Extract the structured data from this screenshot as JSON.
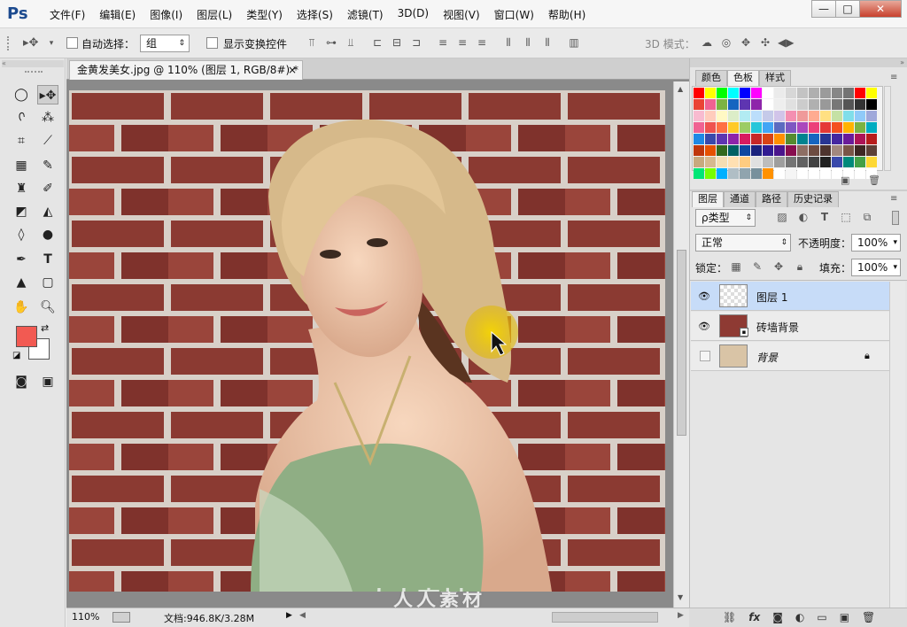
{
  "app": {
    "logo": "Ps"
  },
  "menu": [
    "文件(F)",
    "编辑(E)",
    "图像(I)",
    "图层(L)",
    "类型(Y)",
    "选择(S)",
    "滤镜(T)",
    "3D(D)",
    "视图(V)",
    "窗口(W)",
    "帮助(H)"
  ],
  "window_buttons": {
    "minimize": "—",
    "maximize": "□",
    "close": "✕"
  },
  "options": {
    "auto_select_label": "自动选择：",
    "auto_select_value": "组",
    "show_transform_label": "显示变换控件",
    "mode_3d_label": "3D 模式："
  },
  "document": {
    "tab_title": "金黄发美女.jpg @ 110% (图层 1, RGB/8#) *",
    "close": "×"
  },
  "status": {
    "zoom": "110%",
    "doc_info": "文档:946.8K/3.28M"
  },
  "panels": {
    "top_tabs": [
      "颜色",
      "色板",
      "样式"
    ],
    "layer_tabs": [
      "图层",
      "通道",
      "路径",
      "历史记录"
    ],
    "filter_kind": "ρ类型",
    "blend_mode": "正常",
    "opacity_label": "不透明度：",
    "opacity_value": "100%",
    "lock_label": "锁定：",
    "fill_label": "填充：",
    "fill_value": "100%"
  },
  "layers": [
    {
      "name": "图层 1",
      "visible": true,
      "selected": true
    },
    {
      "name": "砖墙背景",
      "visible": true,
      "selected": false
    },
    {
      "name": "背景",
      "visible": false,
      "selected": false,
      "locked": true
    }
  ],
  "colors": {
    "foreground": "#f25a52",
    "background": "#ffffff",
    "swatches_row1": [
      "#ff0000",
      "#ffff00",
      "#00ff00",
      "#00ffff",
      "#0000ff",
      "#ff00ff",
      "#ffffff",
      "#ebebeb",
      "#d7d7d7",
      "#c3c3c3",
      "#afafaf",
      "#9b9b9b",
      "#878787",
      "#737373",
      "#ff0000",
      "#ffff00"
    ],
    "swatches_rows": [
      [
        "#ea4335",
        "#f06292",
        "#7cb342",
        "#1565c0",
        "#5e35b1",
        "#8e24aa",
        "#ffffff",
        "#eeeeee",
        "#e0e0e0",
        "#cccccc",
        "#b0b0b0",
        "#999999",
        "#777777",
        "#555555",
        "#333333",
        "#000000"
      ],
      [
        "#f8bbd0",
        "#ffccbc",
        "#fff9c4",
        "#dcedc8",
        "#b2ebf2",
        "#bbdefb",
        "#c5cae9",
        "#d1c4e9",
        "#f48fb1",
        "#ef9a9a",
        "#ffab91",
        "#ffe082",
        "#c5e1a5",
        "#80deea",
        "#90caf9",
        "#9fa8da"
      ],
      [
        "#f06292",
        "#ef5350",
        "#ff7043",
        "#ffca28",
        "#9ccc65",
        "#26c6da",
        "#42a5f5",
        "#5c6bc0",
        "#7e57c2",
        "#ab47bc",
        "#ec407a",
        "#e53935",
        "#f4511e",
        "#ffb300",
        "#7cb342",
        "#00acc1"
      ],
      [
        "#1e88e5",
        "#3949ab",
        "#5e35b1",
        "#8e24aa",
        "#d81b60",
        "#c62828",
        "#d84315",
        "#ff8f00",
        "#558b2f",
        "#00838f",
        "#1565c0",
        "#283593",
        "#4527a0",
        "#6a1b9a",
        "#ad1457",
        "#b71c1c"
      ],
      [
        "#bf360c",
        "#e65100",
        "#33691e",
        "#006064",
        "#0d47a1",
        "#1a237e",
        "#311b92",
        "#4a148c",
        "#880e4f",
        "#8d6e63",
        "#6d4c41",
        "#4e342e",
        "#a1887f",
        "#795548",
        "#3e2723",
        "#5d4037"
      ],
      [
        "#c8a97e",
        "#d7b98e",
        "#f5deb3",
        "#ffe0b2",
        "#ffcc80",
        "#e0e0e0",
        "#bdbdbd",
        "#9e9e9e",
        "#757575",
        "#616161",
        "#424242",
        "#212121",
        "#3949ab",
        "#00897b",
        "#43a047",
        "#fdd835"
      ],
      [
        "#00e676",
        "#76ff03",
        "#00b0ff",
        "#b0bec5",
        "#90a4ae",
        "#78909c",
        "#ff9100",
        "#ffffff",
        "#f5f5f5",
        "#ffffff",
        "#ffffff",
        "#ffffff",
        "#ffffff",
        "#ffffff",
        "#ffffff",
        "#ffffff"
      ]
    ]
  },
  "watermark": "人人素材"
}
